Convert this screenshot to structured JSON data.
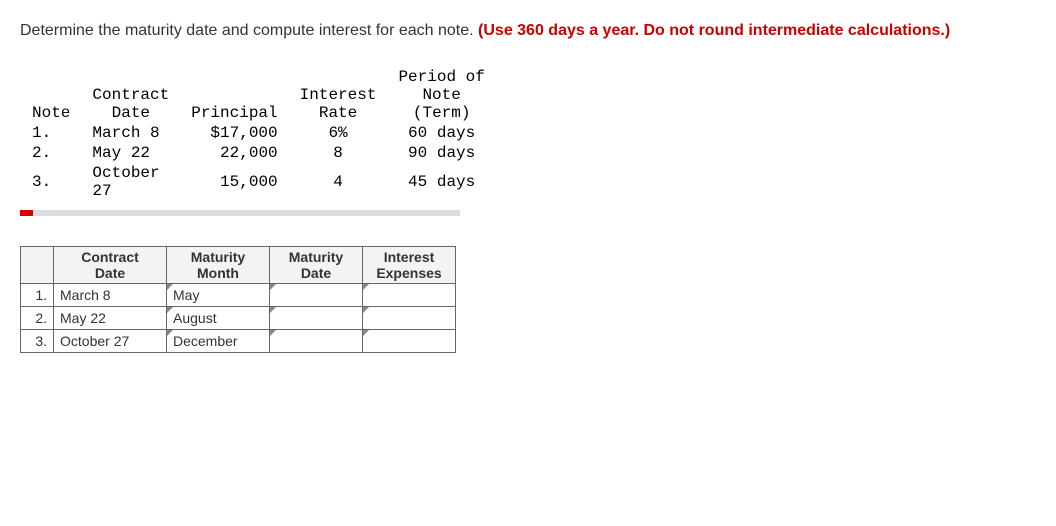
{
  "question": {
    "main_text": "Determine the maturity date and compute interest for each note. ",
    "emphasis_text": "(Use 360 days a year. Do not round intermediate calculations.)"
  },
  "data_headers": {
    "note": "Note",
    "contract_date": "Contract Date",
    "principal": "Principal",
    "interest_rate": "Interest Rate",
    "period": "Period of Note (Term)"
  },
  "data_rows": [
    {
      "num": "1.",
      "date": "March 8",
      "principal": "$17,000",
      "rate": "6%",
      "term": "60 days"
    },
    {
      "num": "2.",
      "date": "May 22",
      "principal": "22,000",
      "rate": "8",
      "term": "90 days"
    },
    {
      "num": "3.",
      "date": "October 27",
      "principal": "15,000",
      "rate": "4",
      "term": "45 days"
    }
  ],
  "answer_headers": {
    "blank": "",
    "contract_date": "Contract Date",
    "maturity_month": "Maturity Month",
    "maturity_date": "Maturity Date",
    "interest_expenses": "Interest Expenses"
  },
  "answer_rows": [
    {
      "num": "1.",
      "contract": "March 8",
      "maturity_month": "May",
      "maturity_date": "",
      "interest": ""
    },
    {
      "num": "2.",
      "contract": "May 22",
      "maturity_month": "August",
      "maturity_date": "",
      "interest": ""
    },
    {
      "num": "3.",
      "contract": "October 27",
      "maturity_month": "December",
      "maturity_date": "",
      "interest": ""
    }
  ]
}
